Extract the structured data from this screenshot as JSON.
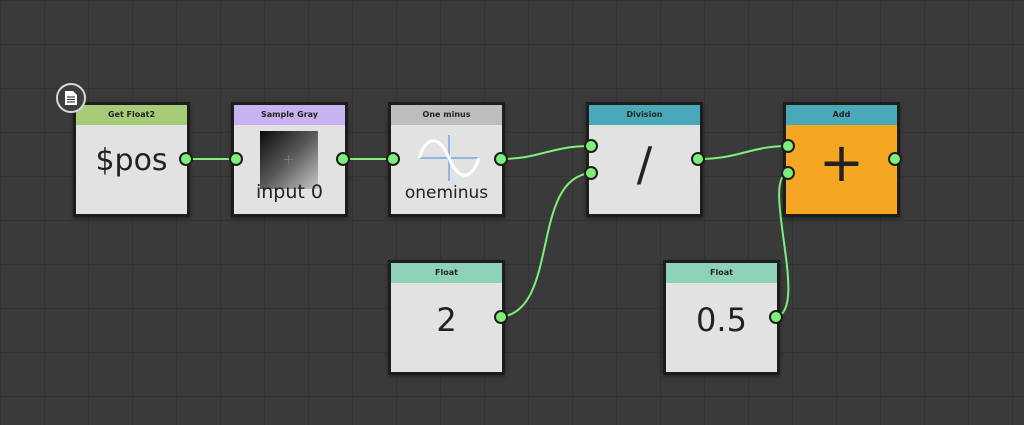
{
  "canvas": {
    "background": "#3a3a3a",
    "grid_color": "#333333",
    "wire_color": "#7ef07a"
  },
  "nodes": {
    "get_float2": {
      "title": "Get Float2",
      "header_color": "#a6cc7a",
      "value": "$pos"
    },
    "sample_gray": {
      "title": "Sample Gray",
      "header_color": "#c7b3f0",
      "caption": "input 0"
    },
    "one_minus": {
      "title": "One minus",
      "header_color": "#bdbdbd",
      "caption": "oneminus"
    },
    "division": {
      "title": "Division",
      "header_color": "#4aa9b8",
      "symbol": "/"
    },
    "add": {
      "title": "Add",
      "header_color": "#4aa9b8",
      "body_color": "#f5a623",
      "symbol": "+"
    },
    "float_a": {
      "title": "Float",
      "header_color": "#8fd3b6",
      "value": "2"
    },
    "float_b": {
      "title": "Float",
      "header_color": "#8fd3b6",
      "value": "0.5"
    }
  },
  "icons": {
    "doc_badge": "document-icon",
    "one_minus_preview": "sine-wave-icon",
    "sample_preview": "gradient-preview-icon"
  }
}
